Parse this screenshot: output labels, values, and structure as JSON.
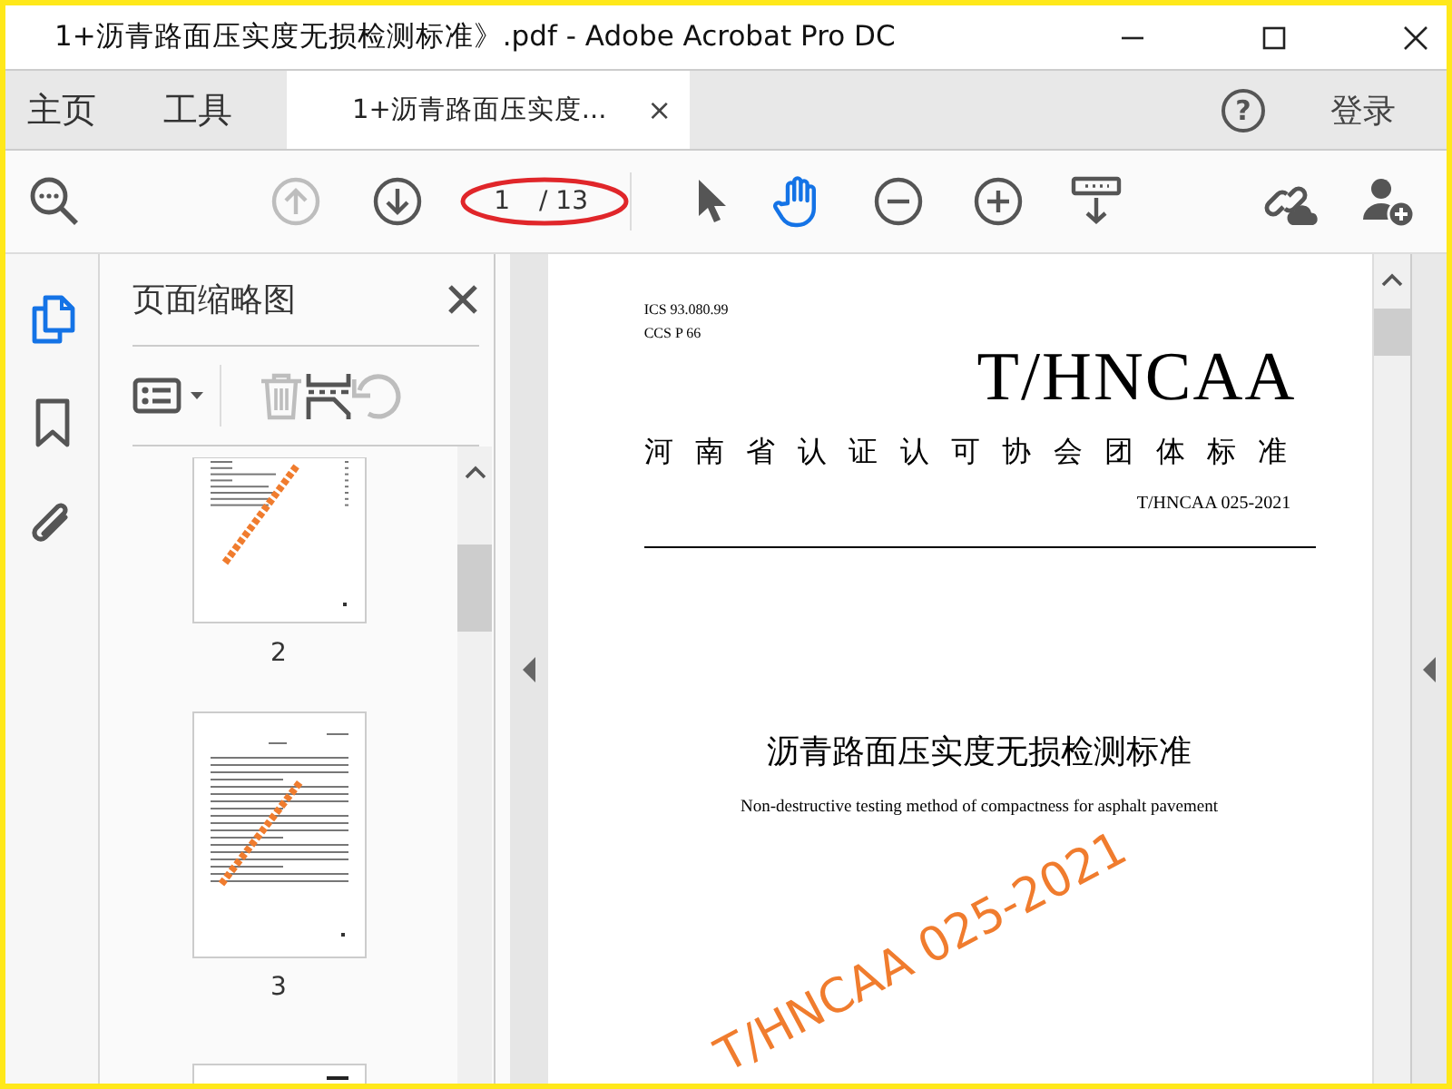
{
  "window": {
    "title": "1+沥青路面压实度无损检测标准》.pdf - Adobe Acrobat Pro DC"
  },
  "tabs": [
    {
      "kind": "nav",
      "label": "主页",
      "selected": false
    },
    {
      "kind": "nav",
      "label": "工具",
      "selected": false
    },
    {
      "kind": "document",
      "label": "1+沥青路面压实度...",
      "close": "×",
      "selected": true
    }
  ],
  "account": {
    "help": "?",
    "login": "登录"
  },
  "toolbar": [
    {
      "kind": "zoom-find"
    },
    {
      "kind": "page-up",
      "disabled": true
    },
    {
      "kind": "page-down",
      "disabled": false
    },
    {
      "kind": "page-field",
      "value": "1",
      "total": "/ 13"
    },
    {
      "kind": "select",
      "selected": false
    },
    {
      "kind": "hand",
      "selected": true
    },
    {
      "kind": "zoom-out"
    },
    {
      "kind": "zoom-in"
    },
    {
      "kind": "scroll-mode"
    },
    {
      "kind": "share-link"
    },
    {
      "kind": "add-user"
    }
  ],
  "side_rail": [
    {
      "kind": "pages",
      "selected": true
    },
    {
      "kind": "bookmarks",
      "selected": false
    },
    {
      "kind": "attachments",
      "selected": false
    }
  ],
  "thumbnails_panel": {
    "title": "页面缩略图",
    "tools": [
      {
        "kind": "options",
        "disabled": false
      },
      {
        "kind": "delete",
        "disabled": true
      },
      {
        "kind": "extract",
        "disabled": false
      },
      {
        "kind": "rotate",
        "disabled": true
      }
    ],
    "pages": [
      {
        "kind": "toc",
        "label": "2",
        "selected": false
      },
      {
        "kind": "text",
        "label": "3",
        "selected": false
      },
      {
        "kind": "partial",
        "selected": false
      }
    ]
  },
  "document": {
    "ics": "ICS 93.080.99",
    "ccs": "CCS P 66",
    "org_code": "T/HNCAA",
    "org_name": "河南省认证认可协会团体标准",
    "standard_no": "T/HNCAA 025-2021",
    "title": "沥青路面压实度无损检测标准",
    "subtitle": "Non-destructive testing method of compactness for asphalt pavement",
    "stamp": "T/HNCAA 025-2021"
  }
}
